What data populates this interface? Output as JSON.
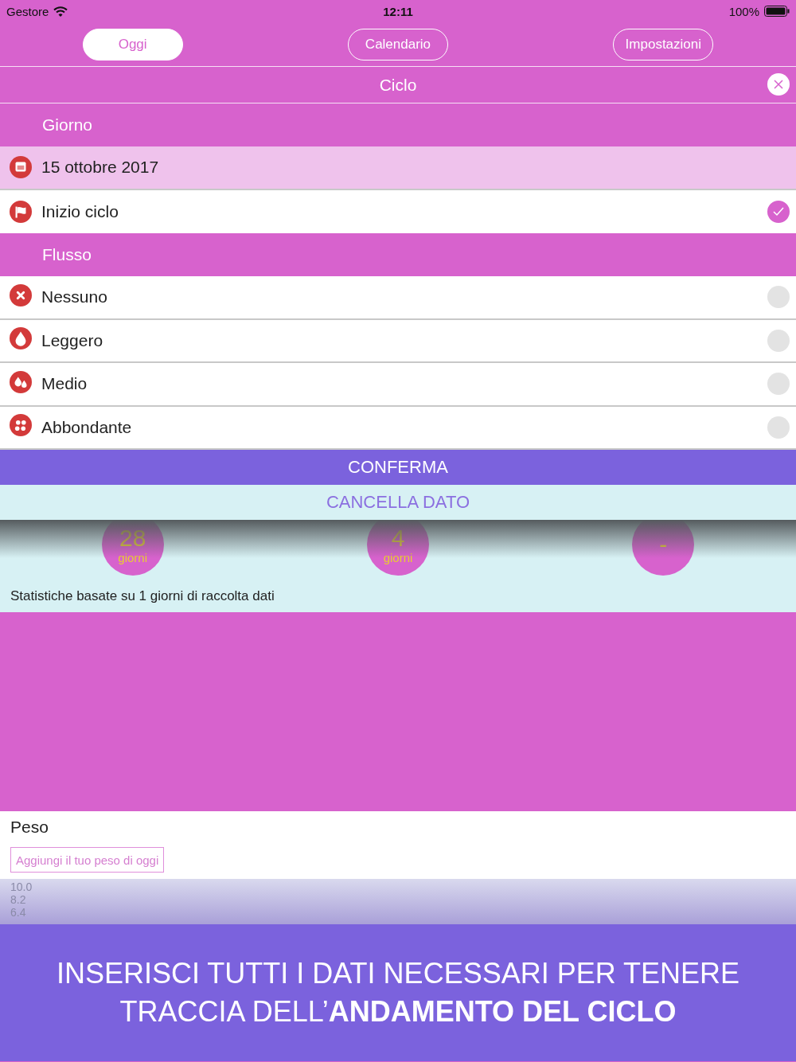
{
  "status_bar": {
    "carrier": "Gestore",
    "time": "12:11",
    "battery": "100%"
  },
  "tabs": [
    {
      "label": "Oggi",
      "selected": true
    },
    {
      "label": "Calendario",
      "selected": false
    },
    {
      "label": "Impostazioni",
      "selected": false
    }
  ],
  "header": {
    "title": "Ciclo"
  },
  "day_section": {
    "title": "Giorno",
    "date": "15 ottobre 2017",
    "cycle_start": {
      "label": "Inizio ciclo",
      "checked": true
    }
  },
  "flow_section": {
    "title": "Flusso",
    "options": [
      {
        "kind": "none",
        "label": "Nessuno",
        "selected": false
      },
      {
        "kind": "light",
        "label": "Leggero",
        "selected": false
      },
      {
        "kind": "medium",
        "label": "Medio",
        "selected": false
      },
      {
        "kind": "heavy",
        "label": "Abbondante",
        "selected": false
      }
    ]
  },
  "buttons": {
    "confirm": "CONFERMA",
    "delete": "CANCELLA DATO"
  },
  "stats": {
    "items": [
      {
        "value": "28",
        "unit": "giorni"
      },
      {
        "value": "4",
        "unit": "giorni"
      },
      {
        "value": "-"
      }
    ],
    "note": "Statistiche basate su 1 giorni di raccolta dati"
  },
  "weight": {
    "title": "Peso",
    "button": "Aggiungi il tuo peso di oggi",
    "axis_labels": [
      "10.0",
      "8.2",
      "6.4"
    ]
  },
  "banner": "INSERISCI TUTTI I DATI NECESSARI PER TENERE TRACCIA DELL’**ANDAMENTO DEL CICLO**"
}
